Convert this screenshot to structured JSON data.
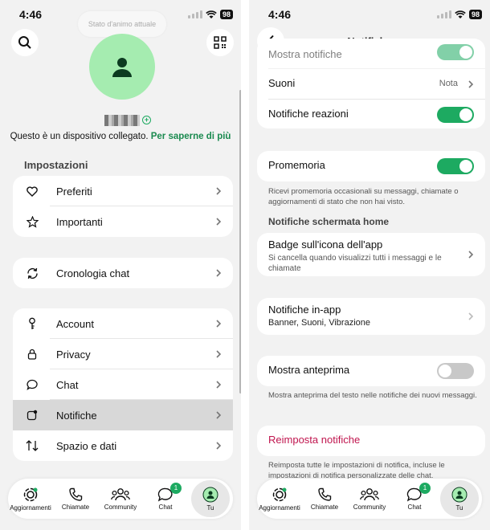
{
  "left_screen": {
    "status_time": "4:46",
    "battery": "98",
    "status_bubble": "Stato d'animo attuale",
    "linked_text": "Questo è un dispositivo collegato.",
    "linked_link": "Per saperne di più",
    "settings_title": "Impostazioni",
    "group1": [
      {
        "label": "Preferiti",
        "icon": "heart-icon"
      },
      {
        "label": "Importanti",
        "icon": "star-icon"
      }
    ],
    "group2": [
      {
        "label": "Cronologia chat",
        "icon": "sync-icon"
      }
    ],
    "group3": [
      {
        "label": "Account",
        "icon": "key-icon"
      },
      {
        "label": "Privacy",
        "icon": "lock-icon"
      },
      {
        "label": "Chat",
        "icon": "chat-bubble-icon"
      },
      {
        "label": "Notifiche",
        "icon": "notification-icon"
      },
      {
        "label": "Spazio e dati",
        "icon": "data-arrows-icon"
      }
    ]
  },
  "right_screen": {
    "status_time": "4:46",
    "battery": "98",
    "title": "Notifiche",
    "show_notifications": "Mostra notifiche",
    "sounds": "Suoni",
    "sounds_value": "Nota",
    "reaction_notifications": "Notifiche reazioni",
    "reminders": "Promemoria",
    "reminders_note": "Ricevi promemoria occasionali su messaggi, chiamate o aggiornamenti di stato che non hai visto.",
    "home_section": "Notifiche schermata home",
    "badge_title": "Badge sull'icona dell'app",
    "badge_sub": "Si cancella quando visualizzi tutti i messaggi e le chiamate",
    "inapp_title": "Notifiche in-app",
    "inapp_sub": "Banner, Suoni, Vibrazione",
    "preview": "Mostra anteprima",
    "preview_note": "Mostra anteprima del testo nelle notifiche dei nuovi messaggi.",
    "reset": "Reimposta notifiche",
    "reset_note": "Reimposta tutte le impostazioni di notifica, incluse le impostazioni di notifica personalizzate delle chat."
  },
  "nav": {
    "items": [
      "Aggiornamenti",
      "Chiamate",
      "Community",
      "Chat",
      "Tu"
    ],
    "chat_badge": "1"
  },
  "colors": {
    "accent": "#1daa61",
    "link": "#1a8a4f",
    "danger": "#c0154e"
  }
}
